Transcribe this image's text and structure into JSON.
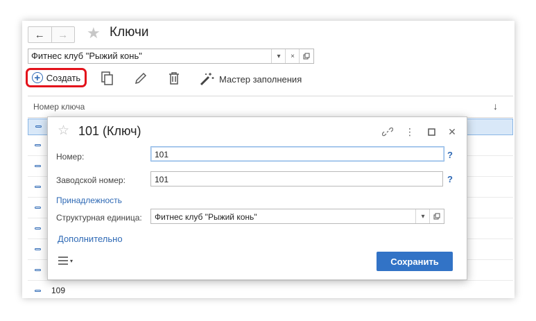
{
  "window": {
    "title": "Ключи",
    "nav": {
      "back": "←",
      "forward": "→"
    },
    "org_combo": {
      "value": "Фитнес клуб \"Рыжий конь\"",
      "clear": "×"
    }
  },
  "toolbar": {
    "create_label": "Создать",
    "master_label": "Мастер заполнения"
  },
  "grid": {
    "header": "Номер ключа",
    "sort": "↓",
    "rows": [
      "",
      "",
      "",
      "",
      "",
      "",
      "",
      "",
      "109"
    ]
  },
  "dialog": {
    "title": "101 (Ключ)",
    "number_label": "Номер:",
    "number_value": "101",
    "serial_label": "Заводской номер:",
    "serial_value": "101",
    "help": "?",
    "group_link": "Принадлежность",
    "unit_label": "Структурная единица:",
    "unit_value": "Фитнес клуб \"Рыжий конь\"",
    "more_link": "Дополнительно",
    "save_label": "Сохранить"
  },
  "colors": {
    "accent": "#3273c6",
    "highlight": "#e3121b",
    "link": "#2e69b5"
  }
}
